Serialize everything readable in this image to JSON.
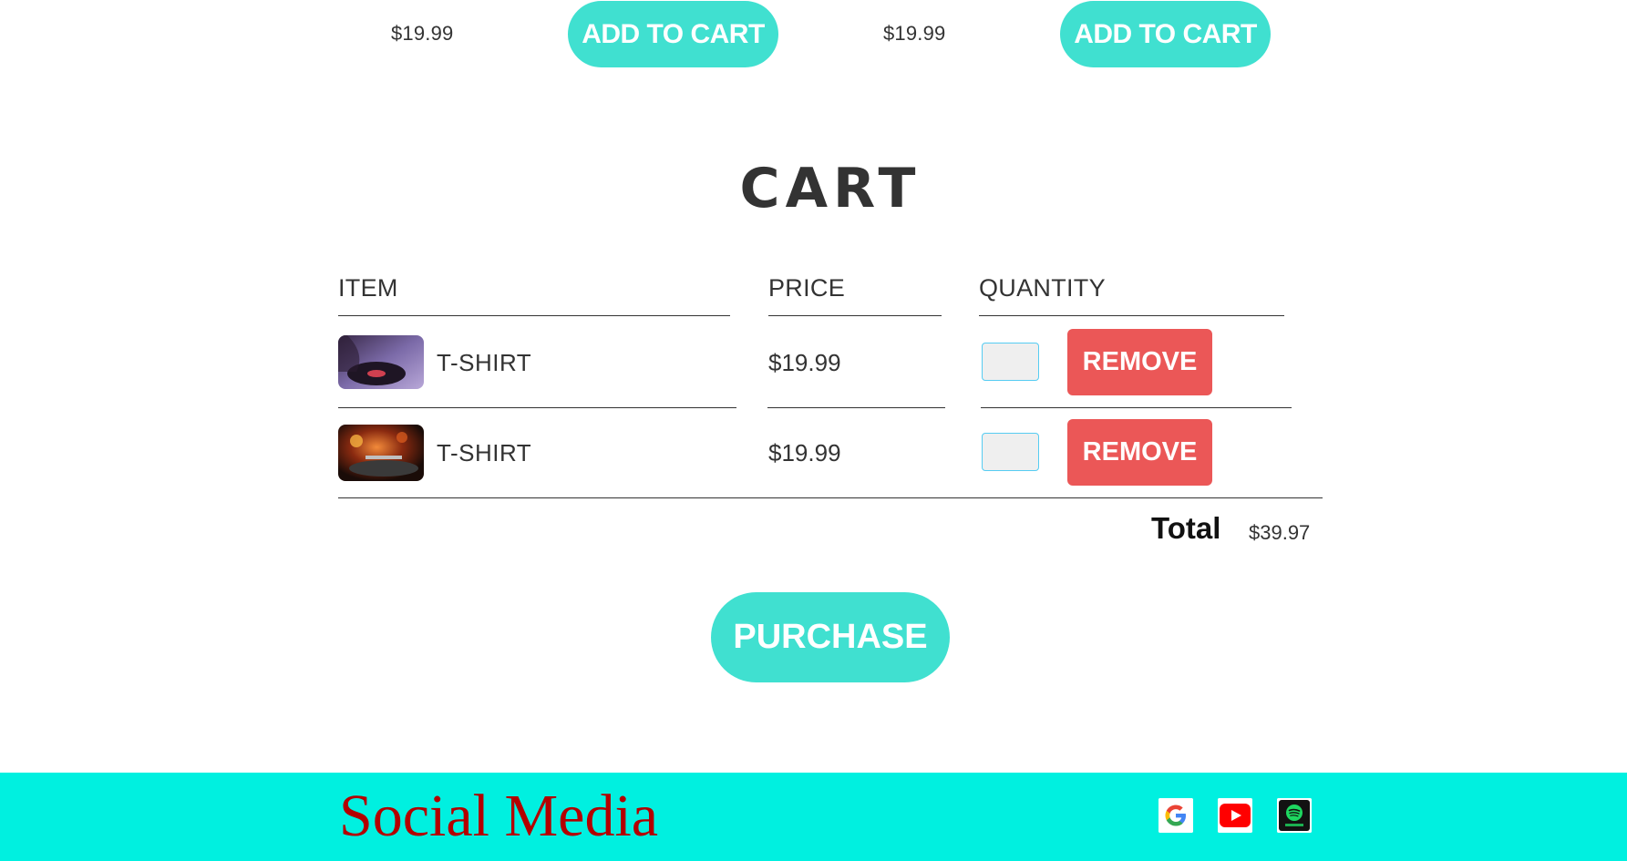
{
  "products": [
    {
      "price": "$19.99",
      "button_label": "ADD TO CART"
    },
    {
      "price": "$19.99",
      "button_label": "ADD TO CART"
    }
  ],
  "cart": {
    "title": "CART",
    "headers": {
      "item": "ITEM",
      "price": "PRICE",
      "quantity": "QUANTITY"
    },
    "rows": [
      {
        "title": "T-SHIRT",
        "price": "$19.99",
        "quantity": "",
        "remove_label": "REMOVE"
      },
      {
        "title": "T-SHIRT",
        "price": "$19.99",
        "quantity": "",
        "remove_label": "REMOVE"
      }
    ],
    "total_label": "Total",
    "total_price": "$39.97"
  },
  "purchase_label": "PURCHASE",
  "footer": {
    "title": "Social Media",
    "icons": [
      "google-icon",
      "youtube-icon",
      "spotify-icon"
    ]
  },
  "colors": {
    "accent": "#40e0d0",
    "danger": "#eb5757",
    "footer_bg": "#00f0e0",
    "footer_text": "#b30000"
  }
}
